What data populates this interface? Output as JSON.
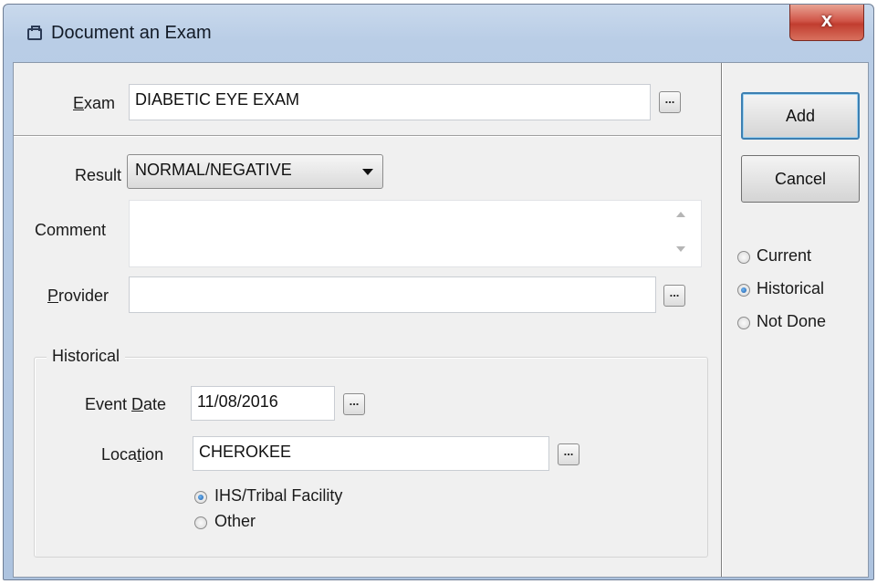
{
  "window": {
    "title": "Document an Exam",
    "close_symbol": "x"
  },
  "exam": {
    "label_underlined": "E",
    "label_rest": "xam",
    "value": "DIABETIC EYE EXAM",
    "browse_label": "..."
  },
  "result": {
    "label": "Result",
    "selected": "NORMAL/NEGATIVE"
  },
  "comment": {
    "label": "Comment",
    "value": ""
  },
  "provider": {
    "label_underlined": "P",
    "label_rest": "rovider",
    "value": "",
    "browse_label": "..."
  },
  "historical": {
    "group_title": "Historical",
    "event_date": {
      "label_prefix": "Event ",
      "label_underlined": "D",
      "label_rest": "ate",
      "value": "11/08/2016",
      "browse_label": "..."
    },
    "location": {
      "label_prefix": "Loca",
      "label_underlined": "t",
      "label_rest": "ion",
      "value": "CHEROKEE",
      "browse_label": "..."
    },
    "facility_options": [
      {
        "label": "IHS/Tribal Facility",
        "selected": true
      },
      {
        "label": "Other",
        "selected": false
      }
    ]
  },
  "buttons": {
    "add": "Add",
    "cancel": "Cancel"
  },
  "status_options": [
    {
      "label": "Current",
      "selected": false
    },
    {
      "label": "Historical",
      "selected": true
    },
    {
      "label": "Not Done",
      "selected": false
    }
  ]
}
